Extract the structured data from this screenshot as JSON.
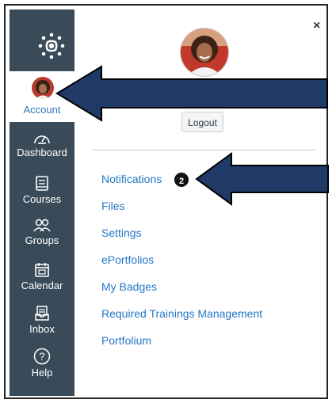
{
  "nav": {
    "account_label": "Account",
    "items": [
      {
        "label": "Dashboard",
        "icon": "dashboard-icon"
      },
      {
        "label": "Courses",
        "icon": "courses-icon"
      },
      {
        "label": "Groups",
        "icon": "groups-icon"
      },
      {
        "label": "Calendar",
        "icon": "calendar-icon"
      },
      {
        "label": "Inbox",
        "icon": "inbox-icon"
      },
      {
        "label": "Help",
        "icon": "help-icon"
      }
    ]
  },
  "tray": {
    "close_symbol": "×",
    "logout_label": "Logout",
    "links": [
      "Notifications",
      "Files",
      "Settings",
      "ePortfolios",
      "My Badges",
      "Required Trainings Management",
      "Portfolium"
    ],
    "notification_badge": "2"
  },
  "colors": {
    "nav_bg": "#394b58",
    "link": "#2477c6",
    "arrow": "#1f3a66"
  }
}
